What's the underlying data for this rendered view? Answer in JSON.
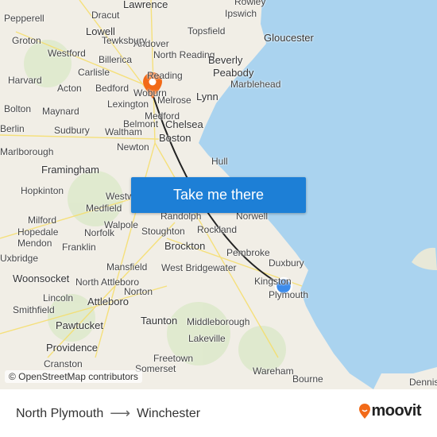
{
  "map": {
    "labels": [
      "Lawrence",
      "Rowley",
      "Pepperell",
      "Dracut",
      "Ipswich",
      "Gloucester",
      "Groton",
      "Lowell",
      "Andover",
      "Topsfield",
      "Tewksbury",
      "Westford",
      "North Reading",
      "Beverly",
      "Billerica",
      "Carlisle",
      "Peabody",
      "Harvard",
      "Acton",
      "Bedford",
      "Reading",
      "Marblehead",
      "Lexington",
      "Woburn",
      "Melrose",
      "Lynn",
      "Bolton",
      "Maynard",
      "Medford",
      "Berlin",
      "Sudbury",
      "Waltham",
      "Belmont",
      "Chelsea",
      "Boston",
      "Newton",
      "Marlborough",
      "Framingham",
      "Hull",
      "Hopkinton",
      "Westwood",
      "Milford",
      "Medfield",
      "Randolph",
      "Norwell",
      "Hopedale",
      "Walpole",
      "Stoughton",
      "Rockland",
      "Mendon",
      "Norfolk",
      "Franklin",
      "Brockton",
      "Pembroke",
      "Uxbridge",
      "Mansfield",
      "West Bridgewater",
      "Duxbury",
      "Woonsocket",
      "North Attleboro",
      "Kingston",
      "Plymouth",
      "Lincoln",
      "Norton",
      "Attleboro",
      "Smithfield",
      "Pawtucket",
      "Taunton",
      "Middleborough",
      "Providence",
      "Lakeville",
      "Freetown",
      "Cranston",
      "Somerset",
      "Wareham",
      "Bourne",
      "Dennis"
    ],
    "attribution": "© OpenStreetMap contributors",
    "cta_label": "Take me there",
    "colors": {
      "land": "#f1eee6",
      "water": "#aad3ef",
      "route": "#222222",
      "origin_pin": "#f26a18",
      "current_location": "#3b8beb",
      "button": "#1d7fd6"
    }
  },
  "footer": {
    "from": "North Plymouth",
    "to": "Winchester",
    "brand": "moovit",
    "brand_color": "#f26a18"
  }
}
